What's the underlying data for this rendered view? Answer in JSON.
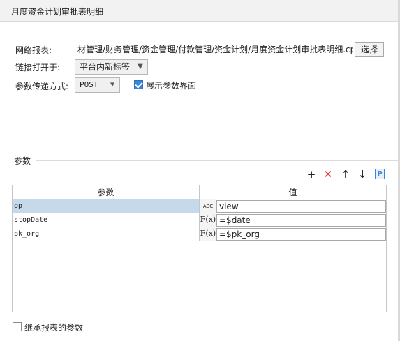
{
  "window": {
    "title": "月度资金计划审批表明细"
  },
  "form": {
    "report_label": "网络报表:",
    "report_path": "材管理/财务管理/资金管理/付款管理/资金计划/月度资金计划审批表明细.cpt",
    "choose_button": "选择",
    "link_open_label": "链接打开于:",
    "link_open_value": "平台内新标签",
    "param_method_label": "参数传递方式:",
    "param_method_value": "POST",
    "show_params_label": "展示参数界面"
  },
  "params": {
    "group_title": "参数",
    "columns": {
      "name": "参数",
      "value": "值"
    },
    "rows": [
      {
        "name": "op",
        "type": "ABC",
        "value": "view",
        "selected": true
      },
      {
        "name": "stopDate",
        "type": "F(x)",
        "value": "=$date",
        "selected": false
      },
      {
        "name": "pk_org",
        "type": "F(x)",
        "value": "=$pk_org",
        "selected": false
      }
    ]
  },
  "footer": {
    "inherit_label": "继承报表的参数"
  },
  "colors": {
    "accent": "#3b86d8",
    "delete": "#e03030",
    "selected_row": "#c6d9ea"
  }
}
